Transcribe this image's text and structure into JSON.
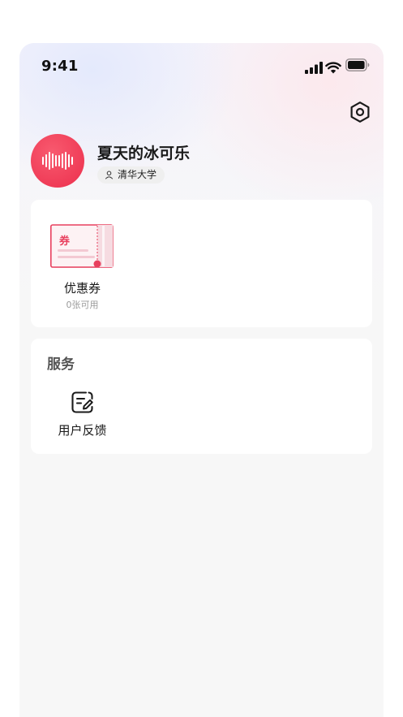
{
  "status_bar": {
    "time": "9:41"
  },
  "profile": {
    "username": "夏天的冰可乐",
    "school": "清华大学",
    "avatar_color": "#ec2f4d"
  },
  "coupon": {
    "badge_text": "券",
    "label": "优惠券",
    "count_text": "0张可用",
    "accent_color": "#ec3d5a"
  },
  "services": {
    "title": "服务",
    "items": [
      {
        "label": "用户反馈",
        "icon": "feedback-edit-icon"
      }
    ]
  },
  "icons": {
    "settings": "hexagon-settings-icon",
    "signal": "cellular-signal-icon",
    "wifi": "wifi-icon",
    "battery": "battery-icon",
    "school": "person-icon"
  }
}
